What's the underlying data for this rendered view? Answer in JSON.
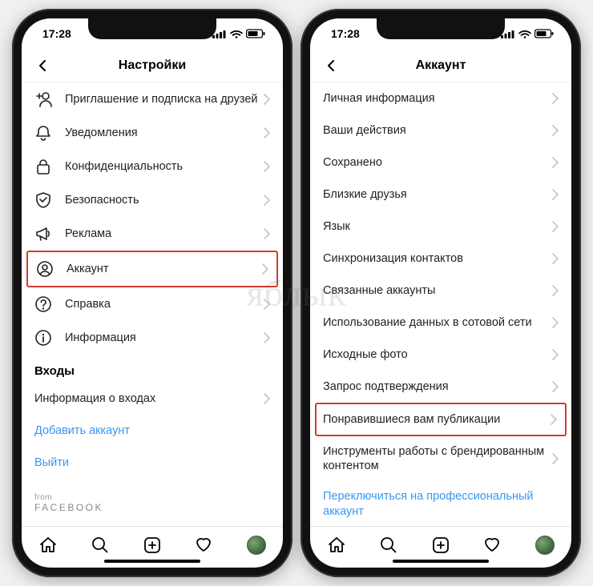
{
  "watermark": "яблык",
  "status": {
    "time": "17:28"
  },
  "left": {
    "title": "Настройки",
    "items": [
      {
        "icon": "add-user-icon",
        "label": "Приглашение и подписка на друзей"
      },
      {
        "icon": "bell-icon",
        "label": "Уведомления"
      },
      {
        "icon": "lock-icon",
        "label": "Конфиденциальность"
      },
      {
        "icon": "shield-icon",
        "label": "Безопасность"
      },
      {
        "icon": "megaphone-icon",
        "label": "Реклама"
      },
      {
        "icon": "user-icon",
        "label": "Аккаунт",
        "highlight": true
      },
      {
        "icon": "help-icon",
        "label": "Справка"
      },
      {
        "icon": "info-icon",
        "label": "Информация"
      }
    ],
    "logins_header": "Входы",
    "login_info": "Информация о входах",
    "add_account": "Добавить аккаунт",
    "logout": "Выйти",
    "from": "from",
    "facebook": "FACEBOOK"
  },
  "right": {
    "title": "Аккаунт",
    "items": [
      {
        "label": "Личная информация"
      },
      {
        "label": "Ваши действия"
      },
      {
        "label": "Сохранено"
      },
      {
        "label": "Близкие друзья"
      },
      {
        "label": "Язык"
      },
      {
        "label": "Синхронизация контактов"
      },
      {
        "label": "Связанные аккаунты"
      },
      {
        "label": "Использование данных в сотовой сети"
      },
      {
        "label": "Исходные фото"
      },
      {
        "label": "Запрос подтверждения"
      },
      {
        "label": "Понравившиеся вам публикации",
        "highlight": true
      },
      {
        "label": "Инструменты работы с брендированным контентом"
      }
    ],
    "switch_pro": "Переключиться на профессиональный аккаунт"
  }
}
